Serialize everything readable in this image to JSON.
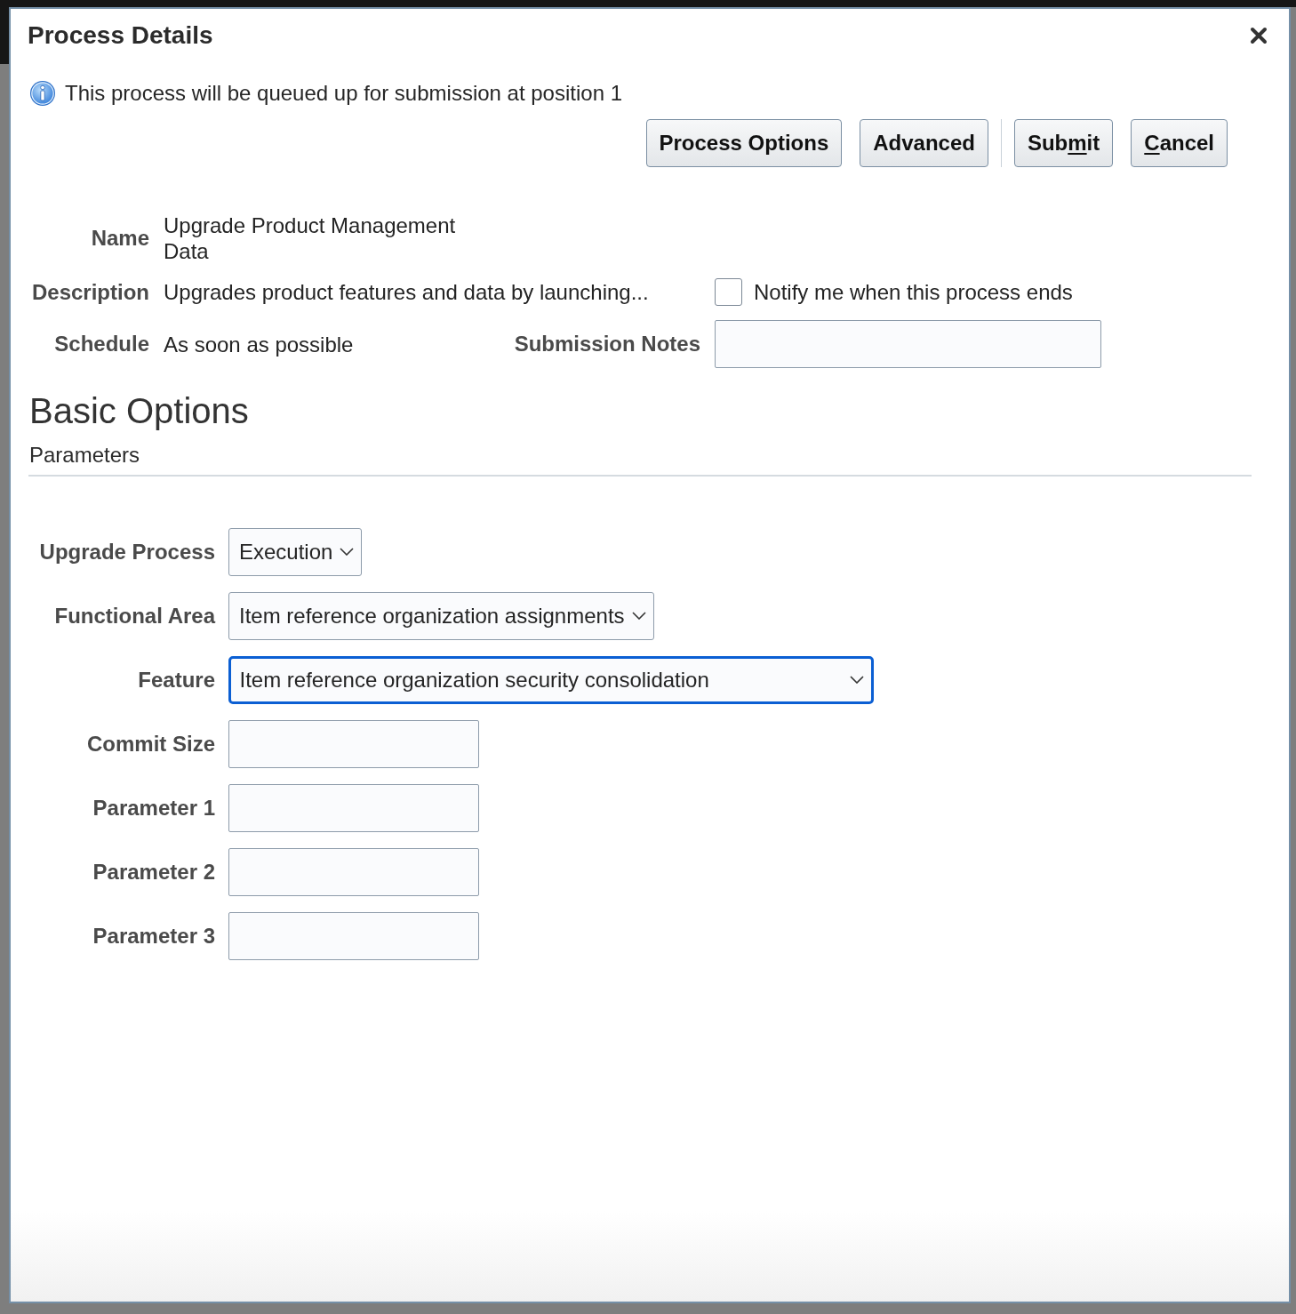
{
  "dialog": {
    "title": "Process Details"
  },
  "info_message": "This process will be queued up for submission at position 1",
  "button_groups": [
    {
      "buttons": [
        {
          "label_parts": [
            {
              "text": "Process Options",
              "underlined": false
            }
          ]
        },
        {
          "label_parts": [
            {
              "text": "Advanced",
              "underlined": false
            }
          ]
        }
      ]
    },
    {
      "buttons": [
        {
          "label_parts": [
            {
              "text": "Sub",
              "underlined": false
            },
            {
              "text": "m",
              "underlined": true
            },
            {
              "text": "it",
              "underlined": false
            }
          ]
        },
        {
          "label_parts": [
            {
              "text": "C",
              "underlined": true
            },
            {
              "text": "ancel",
              "underlined": false
            }
          ]
        }
      ]
    }
  ],
  "details": {
    "name": {
      "label": "Name",
      "value": "Upgrade Product Management Data"
    },
    "description": {
      "label": "Description",
      "value": "Upgrades product features and data by launching..."
    },
    "schedule": {
      "label": "Schedule",
      "value": "As soon as possible"
    },
    "notify": {
      "label": "Notify me when this process ends",
      "checked": false
    },
    "submission_notes": {
      "label": "Submission Notes"
    }
  },
  "section": {
    "title": "Basic Options",
    "subtitle": "Parameters"
  },
  "parameters": [
    {
      "kind": "select",
      "label": "Upgrade Process",
      "value": "Execution",
      "focused": false
    },
    {
      "kind": "select",
      "label": "Functional Area",
      "value": "Item reference organization assignments",
      "focused": false
    },
    {
      "kind": "select",
      "label": "Feature",
      "value": "Item reference organization security consolidation",
      "focused": true
    },
    {
      "kind": "text",
      "label": "Commit Size",
      "focused": false
    },
    {
      "kind": "text",
      "label": "Parameter 1",
      "focused": false
    },
    {
      "kind": "text",
      "label": "Parameter 2",
      "focused": false
    },
    {
      "kind": "text",
      "label": "Parameter 3",
      "focused": false
    }
  ]
}
